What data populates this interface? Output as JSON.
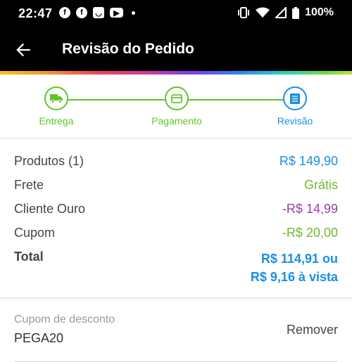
{
  "status_bar": {
    "time": "22:47",
    "notification_icons": [
      "facebook-icon",
      "facebook-icon",
      "shop-icon",
      "youtube-icon"
    ],
    "battery": "100%"
  },
  "app_bar": {
    "title": "Revisão do Pedido"
  },
  "stepper": {
    "steps": [
      {
        "label": "Entrega",
        "icon": "truck-icon",
        "state": "done"
      },
      {
        "label": "Pagamento",
        "icon": "card-icon",
        "state": "done"
      },
      {
        "label": "Revisão",
        "icon": "list-icon",
        "state": "active"
      }
    ]
  },
  "summary": {
    "products_label": "Produtos (1)",
    "products_value": "R$ 149,90",
    "shipping_label": "Frete",
    "shipping_value": "Grátis",
    "gold_label": "Cliente Ouro",
    "gold_value": "-R$ 14,99",
    "coupon_label": "Cupom",
    "coupon_value": "-R$ 20,00",
    "total_label": "Total",
    "total_value_line1": "R$ 114,91 ou",
    "total_value_line2": "R$ 9,16 à vista"
  },
  "coupon": {
    "hint": "Cupom de desconto",
    "code": "PEGA20",
    "remove_label": "Remover"
  },
  "colors": {
    "accent_blue": "#1a8fe3",
    "success_green": "#6cbb2f",
    "discount_purple": "#9b3ea6"
  }
}
